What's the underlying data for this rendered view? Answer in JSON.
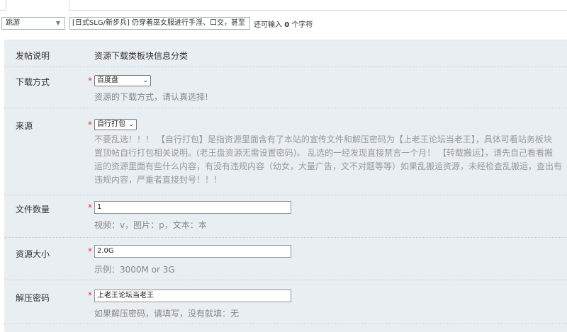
{
  "post": {
    "category": "跳游",
    "title_value": "[日式SLG/新步兵] 仍穿着巫女服进行手淫、口交，甚至",
    "remaining_prefix": "还可输入",
    "remaining_count": "0",
    "remaining_suffix": "个字符"
  },
  "form": {
    "info": {
      "label": "发帖说明",
      "value": "资源下载类板块信息分类"
    },
    "download": {
      "label": "下载方式",
      "required": "*",
      "selected": "百度盘",
      "hint": "资源的下载方式，请认真选择!"
    },
    "source": {
      "label": "来源",
      "required": "*",
      "selected": "自行打包",
      "hint_lines": [
        "不要乱选！！！ 【自行打包】是指资源里面含有了本站的宣传文件和解压密码为【上老王论坛当老王】，具体可看站务板块",
        "置顶帖自行打包相关说明。(老王盘资源无需设置密码)。 乱选的一经发现直接禁言一个月！ 【转载搬运】，请先自己看看搬",
        "运的资源里面有些什么内容，有没有违规内容（幼女，大量广告，文不对题等等）如果乱搬运资源，未经检查乱搬运，查出有",
        "违规内容，严重者直接封号！！！"
      ]
    },
    "file_count": {
      "label": "文件数量",
      "required": "*",
      "value": "1",
      "hint": "视频：v，图片：p，文本：本"
    },
    "size": {
      "label": "资源大小",
      "required": "*",
      "value": "2.0G",
      "hint": "示例：3000M or 3G"
    },
    "password": {
      "label": "解压密码",
      "required": "*",
      "value": "上老王论坛当老王",
      "hint": "如果解压密码，请填写，没有就填：无"
    }
  }
}
